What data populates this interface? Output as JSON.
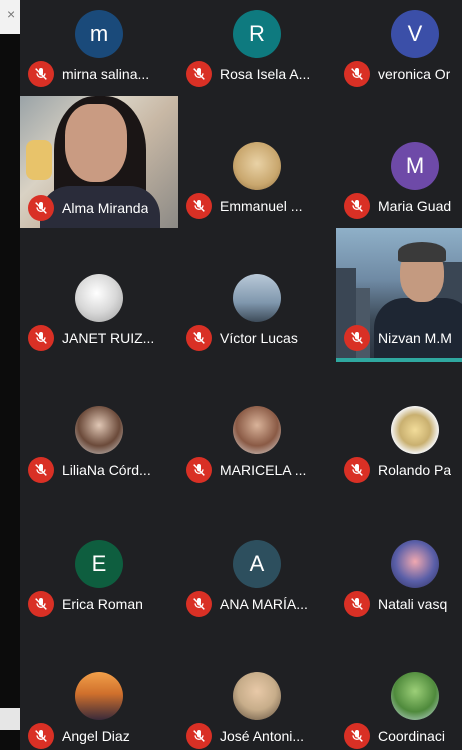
{
  "left_panel": {
    "close_glyph": "×"
  },
  "participants": [
    {
      "name": "mirna salina...",
      "initial": "m",
      "avatar_color": "#1a4a7a",
      "type": "initial"
    },
    {
      "name": "Rosa Isela A...",
      "initial": "R",
      "avatar_color": "#0e7a7f",
      "type": "initial"
    },
    {
      "name": "veronica Or",
      "initial": "V",
      "avatar_color": "#3b4fa8",
      "type": "initial"
    },
    {
      "name": "Alma Miranda",
      "type": "video"
    },
    {
      "name": "Emmanuel ...",
      "avatar_color": "#c9a76e",
      "type": "photo",
      "icon": "dog-photo"
    },
    {
      "name": "Maria Guad",
      "initial": "M",
      "avatar_color": "#6e4aa8",
      "type": "initial"
    },
    {
      "name": "JANET RUIZ...",
      "avatar_color": "#dcdcdc",
      "type": "photo",
      "icon": "sketch-photo"
    },
    {
      "name": "Víctor Lucas",
      "avatar_color": "#7f97ad",
      "type": "photo",
      "icon": "city-photo"
    },
    {
      "name": "Nizvan M.M",
      "type": "video"
    },
    {
      "name": "LiliaNa Córd...",
      "avatar_color": "#6b4a3a",
      "type": "photo",
      "icon": "person-photo"
    },
    {
      "name": "MARICELA ...",
      "avatar_color": "#b08a74",
      "type": "photo",
      "icon": "person-photo"
    },
    {
      "name": "Rolando Pa",
      "avatar_color": "#c9b070",
      "type": "photo",
      "icon": "ring-photo"
    },
    {
      "name": "Erica Roman",
      "initial": "E",
      "avatar_color": "#0e5e3f",
      "type": "initial"
    },
    {
      "name": "ANA MARÍA...",
      "initial": "A",
      "avatar_color": "#2d4f5e",
      "type": "initial"
    },
    {
      "name": "Natali vasq",
      "avatar_color": "#5a5fa8",
      "type": "photo",
      "icon": "cartoon-photo"
    },
    {
      "name": "Angel Diaz",
      "avatar_color": "#d0702c",
      "type": "photo",
      "icon": "sunset-photo"
    },
    {
      "name": "José Antoni...",
      "avatar_color": "#c7ad8a",
      "type": "photo",
      "icon": "person-photo"
    },
    {
      "name": "Coordinaci",
      "avatar_color": "#4f8a3c",
      "type": "photo",
      "icon": "tree-photo"
    }
  ],
  "colors": {
    "muted_badge": "#d93025",
    "background": "#1f2023"
  }
}
